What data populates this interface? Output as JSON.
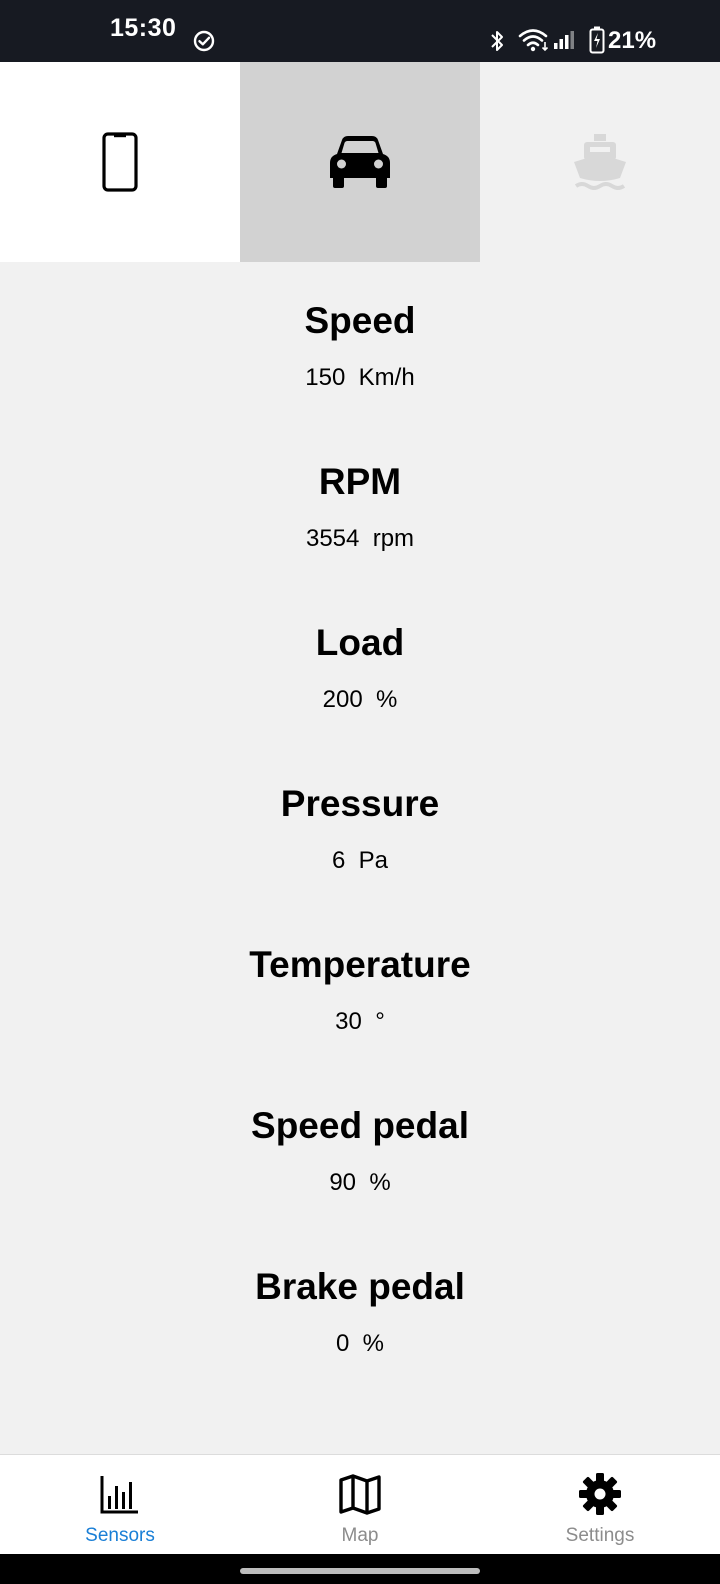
{
  "status_bar": {
    "time": "15:30",
    "battery": "21%",
    "icons": [
      "check-circle-icon",
      "bluetooth-icon",
      "wifi-icon",
      "signal-icon",
      "battery-charging-icon"
    ]
  },
  "mode_tabs": [
    {
      "icon": "smartphone-icon",
      "state": "default"
    },
    {
      "icon": "car-icon",
      "state": "selected"
    },
    {
      "icon": "boat-icon",
      "state": "disabled"
    }
  ],
  "sensors": [
    {
      "title": "Speed",
      "value": "150  Km/h"
    },
    {
      "title": "RPM",
      "value": "3554  rpm"
    },
    {
      "title": "Load",
      "value": "200  %"
    },
    {
      "title": "Pressure",
      "value": "6  Pa"
    },
    {
      "title": "Temperature",
      "value": "30  °"
    },
    {
      "title": "Speed pedal",
      "value": "90  %"
    },
    {
      "title": "Brake pedal",
      "value": "0  %"
    }
  ],
  "bottom_nav": {
    "sensors": {
      "label": "Sensors",
      "icon": "bar-chart-icon"
    },
    "map": {
      "label": "Map",
      "icon": "map-icon"
    },
    "settings": {
      "label": "Settings",
      "icon": "gear-icon"
    }
  },
  "colors": {
    "status_bar_bg": "#171a22",
    "page_bg": "#f1f1f1",
    "selected_tab_bg": "#d2d2d2",
    "accent": "#1a7fd6",
    "inactive_nav": "#8c8c8c",
    "disabled_icon": "#d8d8d8"
  }
}
